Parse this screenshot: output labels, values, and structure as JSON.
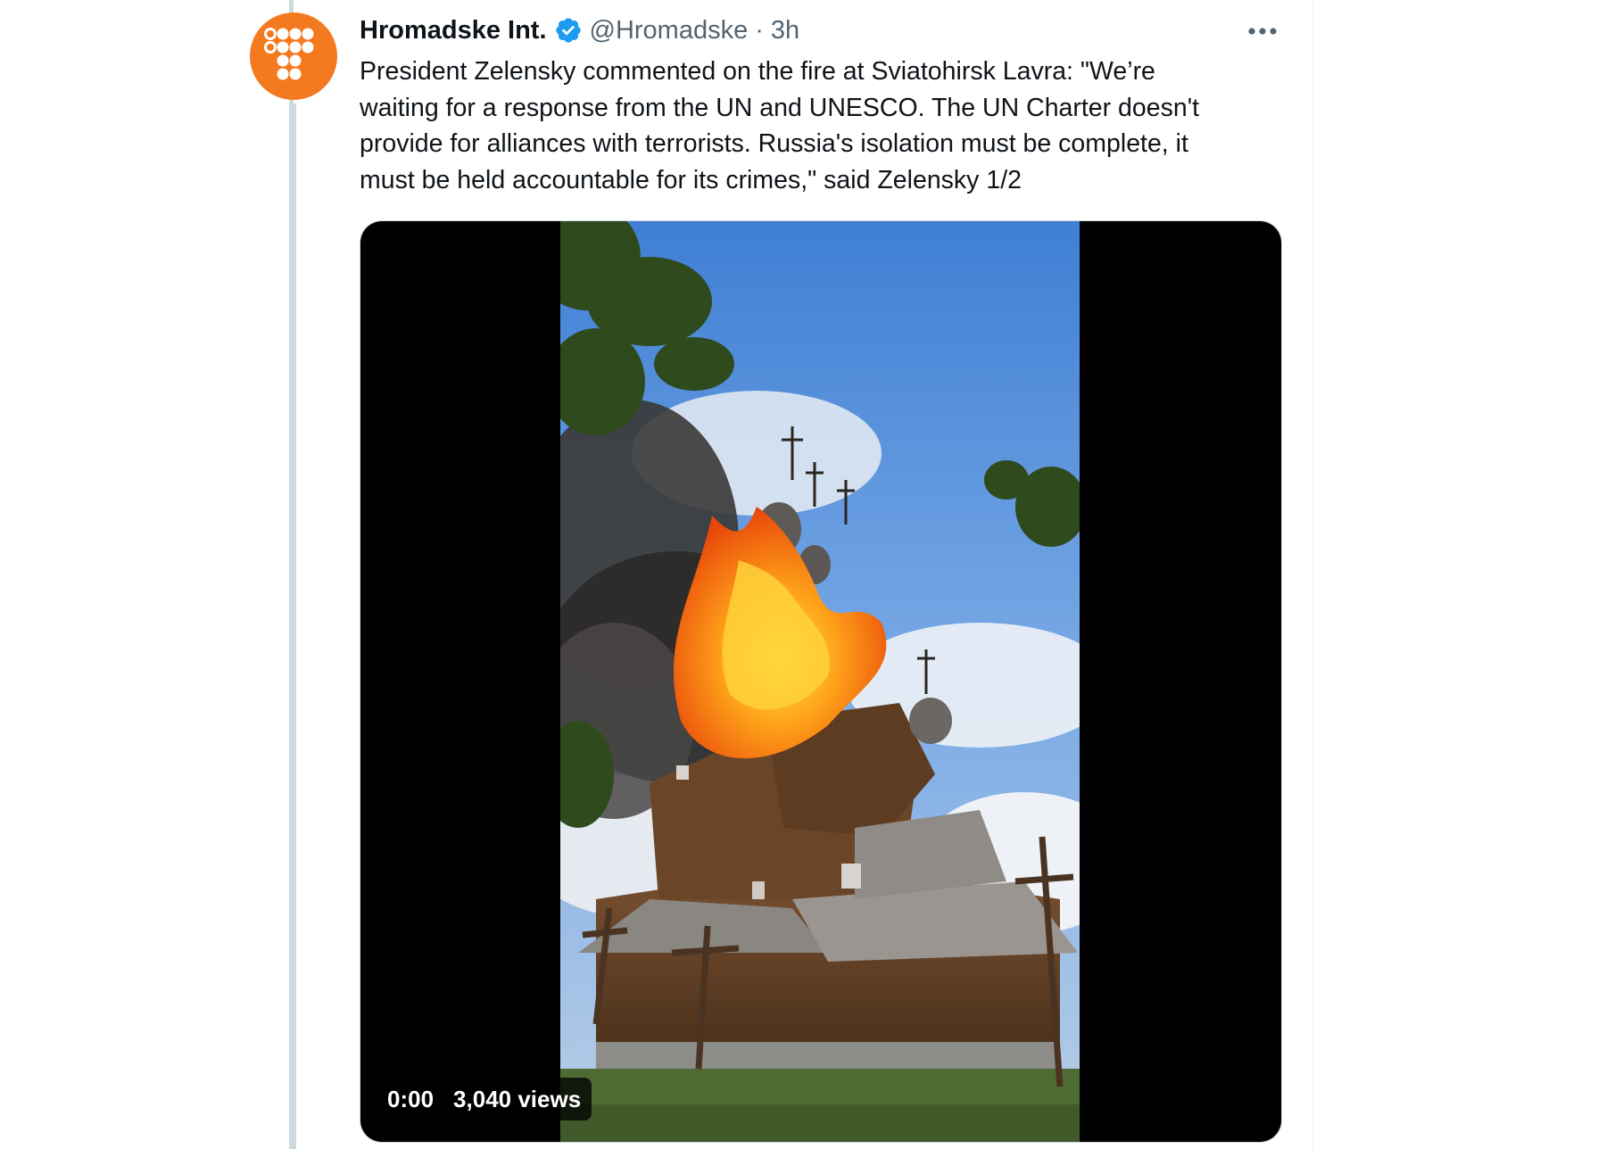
{
  "tweet": {
    "author": {
      "display_name": "Hromadske Int.",
      "handle": "@Hromadske",
      "verified": true,
      "avatar_icon": "hromadske-dots-logo",
      "avatar_color": "#f47a20"
    },
    "separator": "·",
    "timestamp": "3h",
    "more_icon": "more-horizontal-icon",
    "text_lines": [
      "President Zelensky commented on the fire at Sviatohirsk Lavra: \"We’re",
      "waiting for a response from the UN and UNESCO. The UN Charter doesn't",
      "provide for alliances with terrorists. Russia's isolation must be complete, it",
      "must be held accountable for its crimes,\" said Zelensky 1/2"
    ],
    "media": {
      "type": "video",
      "time": "0:00",
      "views": "3,040 views"
    }
  },
  "colors": {
    "verified_blue": "#1d9bf0",
    "secondary_text": "#536471",
    "divider": "#cfd9de"
  }
}
